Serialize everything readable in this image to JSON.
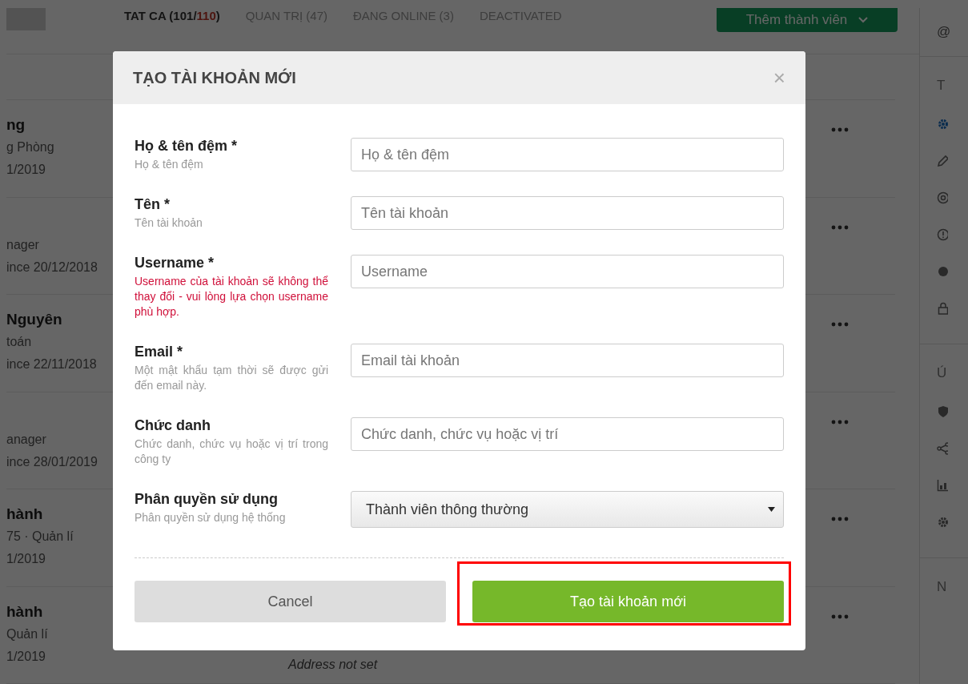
{
  "tabs": [
    {
      "label_parts": [
        "TAT CA (101/",
        "110",
        ")"
      ],
      "selected": true
    },
    {
      "label_parts": [
        "QUAN TRỊ (47)"
      ],
      "selected": false
    },
    {
      "label_parts": [
        "ĐANG ONLINE (3)"
      ],
      "selected": false
    },
    {
      "label_parts": [
        "DEACTIVATED"
      ],
      "selected": false
    }
  ],
  "add_button": {
    "label": "Thêm thành viên"
  },
  "members": [
    {
      "name": "ng",
      "subtitle": "g Phòng",
      "since": "1/2019"
    },
    {
      "subtitle": "nager",
      "since": "ince 20/12/2018"
    },
    {
      "name": "Nguyên",
      "subtitle": "toán",
      "since": "ince 22/11/2018"
    },
    {
      "subtitle": "anager",
      "since": "ince 28/01/2019"
    },
    {
      "name": "hành",
      "subtitle": "75 · Quản lí",
      "since": "1/2019"
    },
    {
      "name": "hành",
      "subtitle": "Quản lí",
      "since": "1/2019",
      "address": "Address not set"
    }
  ],
  "sidebar": {
    "handle": "@",
    "sections": [
      {
        "title": "T",
        "items": [
          {
            "kind": "gear",
            "selected": true
          },
          {
            "kind": "pencil",
            "selected": false
          },
          {
            "kind": "at",
            "selected": false
          },
          {
            "kind": "alert",
            "selected": false
          },
          {
            "kind": "dot",
            "selected": false
          },
          {
            "kind": "lock",
            "selected": false
          }
        ]
      },
      {
        "title": "Ú",
        "items": [
          {
            "kind": "shield",
            "selected": false
          },
          {
            "kind": "share",
            "selected": false
          },
          {
            "kind": "chart",
            "selected": false
          },
          {
            "kind": "gear",
            "selected": false
          }
        ]
      },
      {
        "title": "N"
      }
    ]
  },
  "modal": {
    "title": "TẠO TÀI KHOẢN MỚI",
    "close": "×",
    "fields": [
      {
        "kind": "input",
        "label": "Họ & tên đệm *",
        "hint": "Họ & tên đệm",
        "warning": false,
        "placeholder": "Họ & tên đệm"
      },
      {
        "kind": "input",
        "label": "Tên *",
        "hint": "Tên tài khoản",
        "warning": false,
        "placeholder": "Tên tài khoản"
      },
      {
        "kind": "input",
        "label": "Username *",
        "hint": "Username của tài khoản sẽ không thể thay đổi - vui lòng lựa chọn username phù hợp.",
        "warning": true,
        "placeholder": "Username"
      },
      {
        "kind": "input",
        "label": "Email *",
        "hint": "Một mật khẩu tạm thời sẽ được gửi đến email này.",
        "warning": false,
        "placeholder": "Email tài khoản"
      },
      {
        "kind": "input",
        "label": "Chức danh",
        "hint": "Chức danh, chức vụ hoặc vị trí trong công ty",
        "warning": false,
        "placeholder": "Chức danh, chức vụ hoặc vị trí"
      },
      {
        "kind": "select",
        "label": "Phân quyền sử dụng",
        "hint": "Phân quyền sử dụng hệ thống",
        "warning": false,
        "value": "Thành viên thông thường"
      }
    ],
    "cancel": "Cancel",
    "submit": "Tạo tài khoản mới",
    "submit_highlighted": true
  }
}
